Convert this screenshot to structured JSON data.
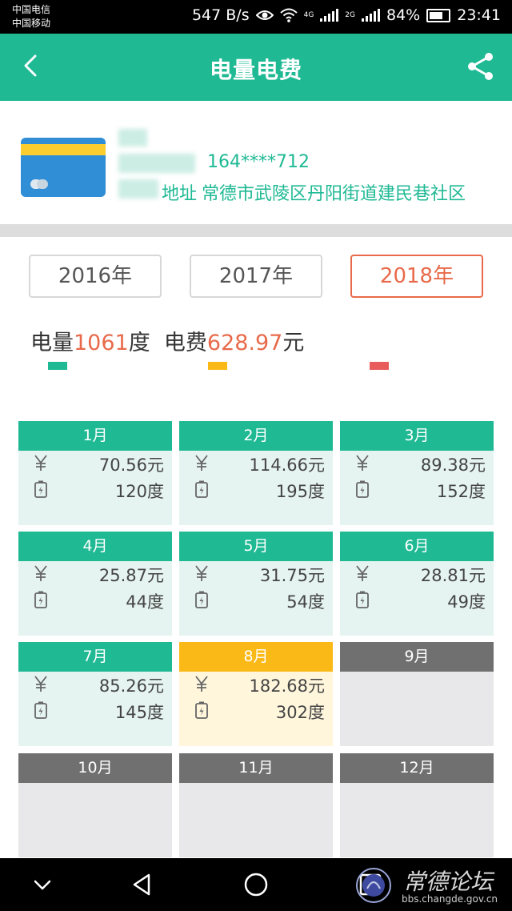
{
  "status_bar": {
    "carrier_1": "中国电信",
    "carrier_2": "中国移动",
    "net_speed": "547 B/s",
    "net_4g": "4G",
    "net_2g": "2G",
    "battery": "84%",
    "time": "23:41"
  },
  "header": {
    "title": "电量电费",
    "back_icon": "chevron-left-icon",
    "share_icon": "share-icon"
  },
  "account": {
    "card_icon": "bank-card-icon",
    "number": "164****712",
    "address_label": "地址",
    "address": "常德市武陵区丹阳街道建民巷社区"
  },
  "years": {
    "items": [
      "2016年",
      "2017年",
      "2018年"
    ],
    "selected": "2018年"
  },
  "summary": {
    "kwh_label": "电量",
    "kwh_value": "1061",
    "kwh_unit": "度",
    "fee_label": "电费",
    "fee_value": "628.97",
    "fee_unit": "元"
  },
  "legend": {
    "tier_1_color": "#1fb994",
    "tier_2_color": "#fbb917",
    "tier_3_color": "#e85c5c"
  },
  "months": [
    {
      "label": "1月",
      "fee": "70.56元",
      "kwh": "120度",
      "state": "normal"
    },
    {
      "label": "2月",
      "fee": "114.66元",
      "kwh": "195度",
      "state": "normal"
    },
    {
      "label": "3月",
      "fee": "89.38元",
      "kwh": "152度",
      "state": "normal"
    },
    {
      "label": "4月",
      "fee": "25.87元",
      "kwh": "44度",
      "state": "normal"
    },
    {
      "label": "5月",
      "fee": "31.75元",
      "kwh": "54度",
      "state": "normal"
    },
    {
      "label": "6月",
      "fee": "28.81元",
      "kwh": "49度",
      "state": "normal"
    },
    {
      "label": "7月",
      "fee": "85.26元",
      "kwh": "145度",
      "state": "normal"
    },
    {
      "label": "8月",
      "fee": "182.68元",
      "kwh": "302度",
      "state": "peak"
    },
    {
      "label": "9月",
      "state": "empty"
    },
    {
      "label": "10月",
      "state": "empty"
    },
    {
      "label": "11月",
      "state": "empty"
    },
    {
      "label": "12月",
      "state": "empty"
    }
  ],
  "month_icons": {
    "fee": "yen-icon",
    "kwh": "battery-bolt-icon"
  },
  "nav": {
    "collapse_icon": "chevron-down-icon",
    "back_icon": "triangle-back-icon",
    "home_icon": "circle-home-icon",
    "recents_icon": "square-recents-icon"
  },
  "watermark": {
    "title": "常德论坛",
    "url": "bbs.changde.gov.cn"
  },
  "colors": {
    "primary": "#1fb994",
    "accent": "#e86a4a",
    "peak": "#fbb917",
    "empty": "#707070"
  }
}
